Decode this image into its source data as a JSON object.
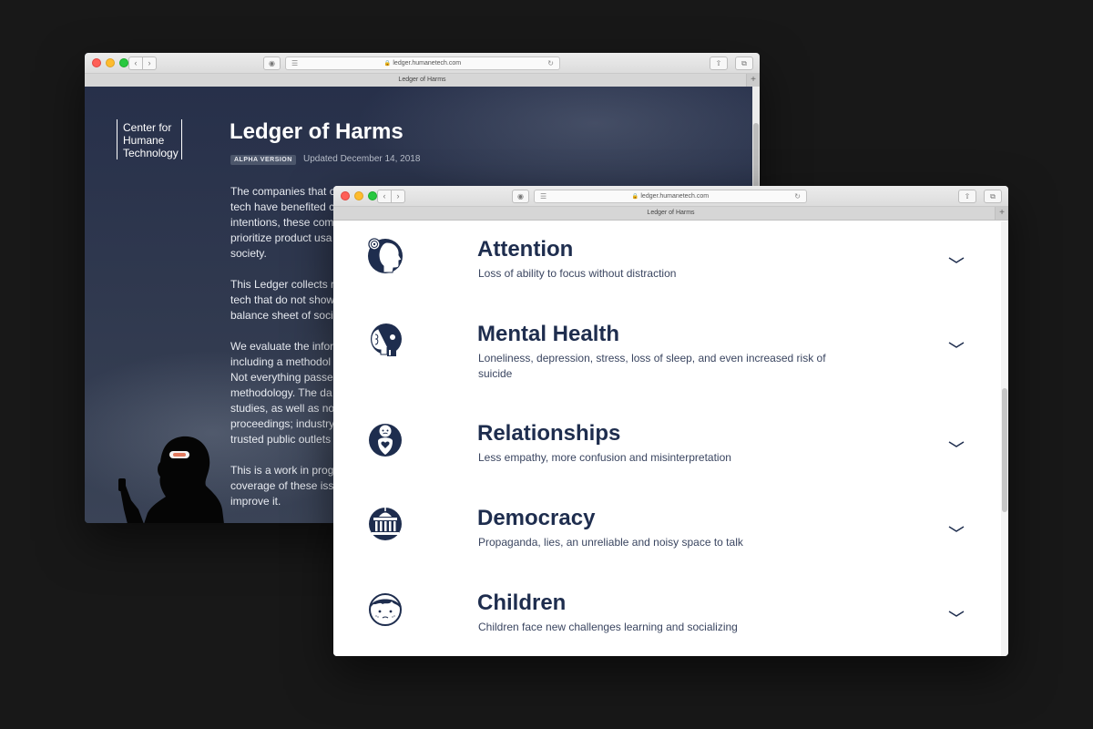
{
  "back_window": {
    "url": "ledger.humanetech.com",
    "tab_title": "Ledger of Harms",
    "logo_lines": [
      "Center for",
      "Humane",
      "Technology"
    ],
    "page_title": "Ledger of Harms",
    "badge": "ALPHA VERSION",
    "updated": "Updated December 14, 2018",
    "paragraphs": [
      [
        "The companies that c",
        "tech have benefited c",
        "intentions, these com",
        "prioritize product usa",
        "society."
      ],
      [
        "This Ledger collects r",
        "tech that do not show",
        "balance sheet of soci"
      ],
      [
        "We evaluate the infor",
        "including a methodol",
        "Not everything passe",
        "methodology. The da",
        "studies, as well as no",
        "proceedings; industry",
        "trusted public outlets"
      ],
      [
        "This is a work in prog",
        "coverage of these iss",
        "improve it."
      ]
    ]
  },
  "front_window": {
    "url": "ledger.humanetech.com",
    "tab_title": "Ledger of Harms",
    "harms": [
      {
        "title": "Attention",
        "description": "Loss of ability to focus without distraction",
        "icon": "attention-head-icon"
      },
      {
        "title": "Mental Health",
        "description": "Loneliness, depression, stress, loss of sleep, and even increased risk of suicide",
        "icon": "mental-health-icon"
      },
      {
        "title": "Relationships",
        "description": "Less empathy, more confusion and misinterpretation",
        "icon": "relationships-icon"
      },
      {
        "title": "Democracy",
        "description": "Propaganda, lies, an unreliable and noisy space to talk",
        "icon": "democracy-capitol-icon"
      },
      {
        "title": "Children",
        "description": "Children face new challenges learning and socializing",
        "icon": "children-face-icon"
      }
    ]
  },
  "colors": {
    "navy": "#1e2d4e",
    "background": "#181818",
    "hero_bg": "#2d3648"
  }
}
